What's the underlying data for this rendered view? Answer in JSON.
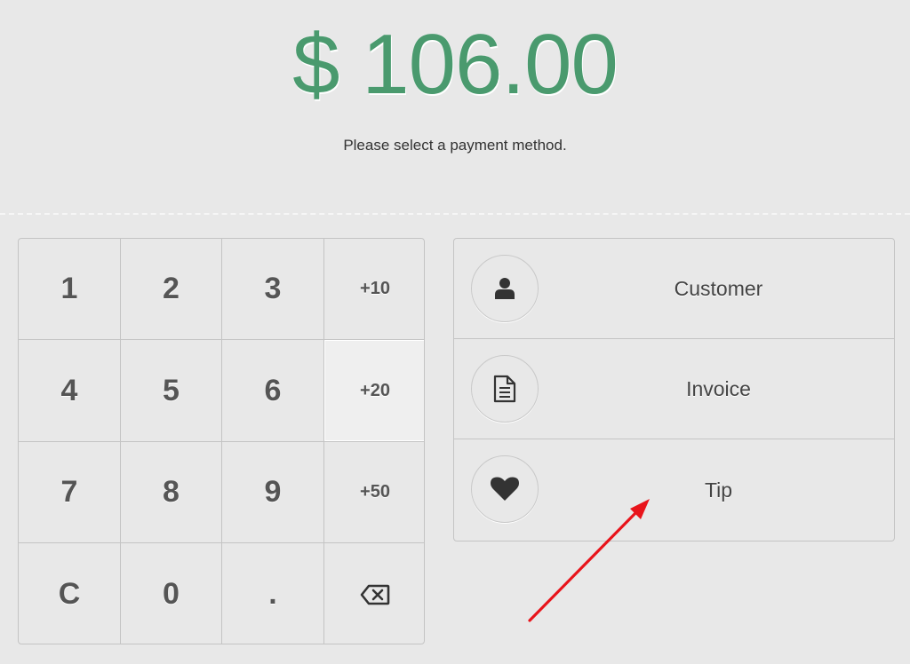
{
  "amount": "$ 106.00",
  "message": "Please select a payment method.",
  "keypad": {
    "keys": [
      {
        "label": "1",
        "name": "key-1"
      },
      {
        "label": "2",
        "name": "key-2"
      },
      {
        "label": "3",
        "name": "key-3"
      },
      {
        "label": "+10",
        "name": "key-plus-10"
      },
      {
        "label": "4",
        "name": "key-4"
      },
      {
        "label": "5",
        "name": "key-5"
      },
      {
        "label": "6",
        "name": "key-6"
      },
      {
        "label": "+20",
        "name": "key-plus-20"
      },
      {
        "label": "7",
        "name": "key-7"
      },
      {
        "label": "8",
        "name": "key-8"
      },
      {
        "label": "9",
        "name": "key-9"
      },
      {
        "label": "+50",
        "name": "key-plus-50"
      },
      {
        "label": "C",
        "name": "key-clear"
      },
      {
        "label": "0",
        "name": "key-0"
      },
      {
        "label": ".",
        "name": "key-decimal"
      },
      {
        "label": "",
        "name": "key-backspace",
        "icon": "backspace-icon"
      }
    ]
  },
  "methods": [
    {
      "label": "Customer",
      "icon": "user-icon"
    },
    {
      "label": "Invoice",
      "icon": "document-icon"
    },
    {
      "label": "Tip",
      "icon": "heart-icon"
    }
  ],
  "colors": {
    "amount": "#4a9a6e",
    "background": "#e8e8e8",
    "annotation_arrow": "#e8141b"
  }
}
